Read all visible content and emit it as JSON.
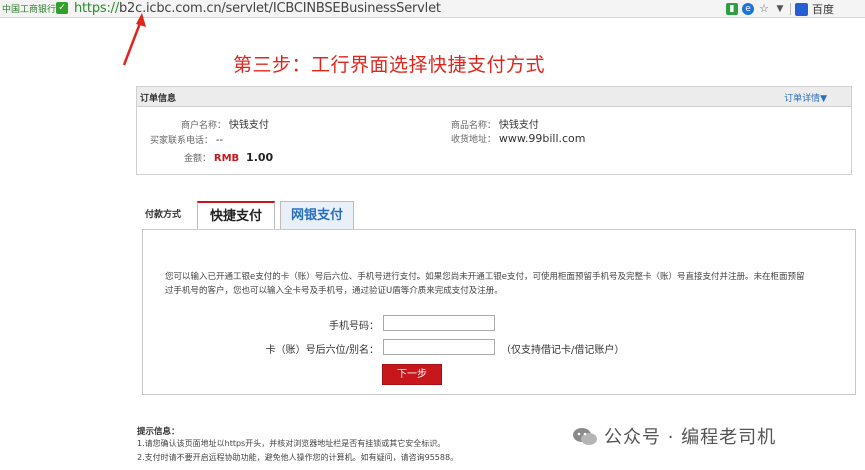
{
  "browser": {
    "site_identity": "中国工商银行",
    "url_scheme": "https://",
    "url_rest": "b2c.icbc.com.cn/servlet/ICBCINBSEBusinessServlet",
    "search_engine": "百度"
  },
  "annotation": {
    "title": "第三步：工行界面选择快捷支付方式",
    "color": "#e0261c"
  },
  "order": {
    "section_title": "订单信息",
    "detail_link": "订单详情▼",
    "merchant_label": "商户名称：",
    "merchant_value": "快钱支付",
    "product_label": "商品名称：",
    "product_value": "快钱支付",
    "buyer_phone_label": "买家联系电话：",
    "buyer_phone_value": "--",
    "address_label": "收货地址：",
    "address_value": "www.99bill.com",
    "amount_label": "金额：",
    "amount_currency": "RMB",
    "amount_value": "1.00"
  },
  "payment": {
    "method_label": "付款方式",
    "tabs": [
      {
        "label": "快捷支付",
        "active": true
      },
      {
        "label": "网银支付",
        "active": false
      }
    ],
    "description": "您可以输入已开通工银e支付的卡（账）号后六位、手机号进行支付。如果您尚未开通工银e支付，可使用柜面预留手机号及完整卡（账）号直接支付并注册。未在柜面预留过手机号的客户，您也可以输入全卡号及手机号，通过验证U盾等介质来完成支付及注册。",
    "phone_label": "手机号码：",
    "phone_value": "",
    "card_label": "卡（账）号后六位/别名：",
    "card_value": "",
    "card_hint": "（仅支持借记卡/借记账户）",
    "next_button": "下一步"
  },
  "tips": {
    "title": "提示信息：",
    "lines": [
      "1.请您确认该页面地址以https开头，并核对浏览器地址栏是否有挂锁或其它安全标识。",
      "2.支付时请不要开启远程协助功能，避免他人操作您的计算机。如有疑问，请咨询95588。"
    ]
  },
  "watermark": {
    "text": "公众号 · 编程老司机"
  },
  "colors": {
    "brand_red": "#c8161d",
    "link_blue": "#2a6fbf"
  }
}
